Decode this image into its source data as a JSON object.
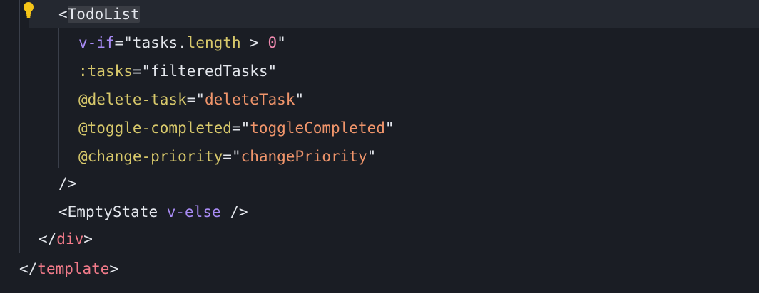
{
  "editor": {
    "lines": {
      "l1": {
        "open": "<",
        "component": "TodoList"
      },
      "l2": {
        "directive": "v-if",
        "eq": "=",
        "q1": "\"",
        "expr1": "tasks.",
        "prop": "length",
        "op": " > ",
        "num": "0",
        "q2": "\""
      },
      "l3": {
        "attr": ":tasks",
        "eq": "=",
        "value": "\"filteredTasks\""
      },
      "l4": {
        "attr": "@delete-task",
        "eq": "=\"",
        "value": "deleteTask",
        "close": "\""
      },
      "l5": {
        "attr": "@toggle-completed",
        "eq": "=\"",
        "value": "toggleCompleted",
        "close": "\""
      },
      "l6": {
        "attr": "@change-priority",
        "eq": "=\"",
        "value": "changePriority",
        "close": "\""
      },
      "l7": {
        "text": "/>"
      },
      "l8": {
        "open": "<",
        "component": "EmptyState",
        "space": " ",
        "directive": "v-else",
        "close": " />"
      },
      "l9": {
        "open": "</",
        "tag": "div",
        "close": ">"
      },
      "l10": {
        "open": "</",
        "tag": "template",
        "close": ">"
      }
    },
    "icons": {
      "bulb": "lightbulb-icon"
    },
    "colors": {
      "background": "#1a1d24",
      "tag": "#f27b8a",
      "directive": "#a88bf4",
      "attribute": "#d7c86b",
      "string": "#f0956b",
      "number": "#f08ab0",
      "bulb": "#f5c518"
    }
  }
}
